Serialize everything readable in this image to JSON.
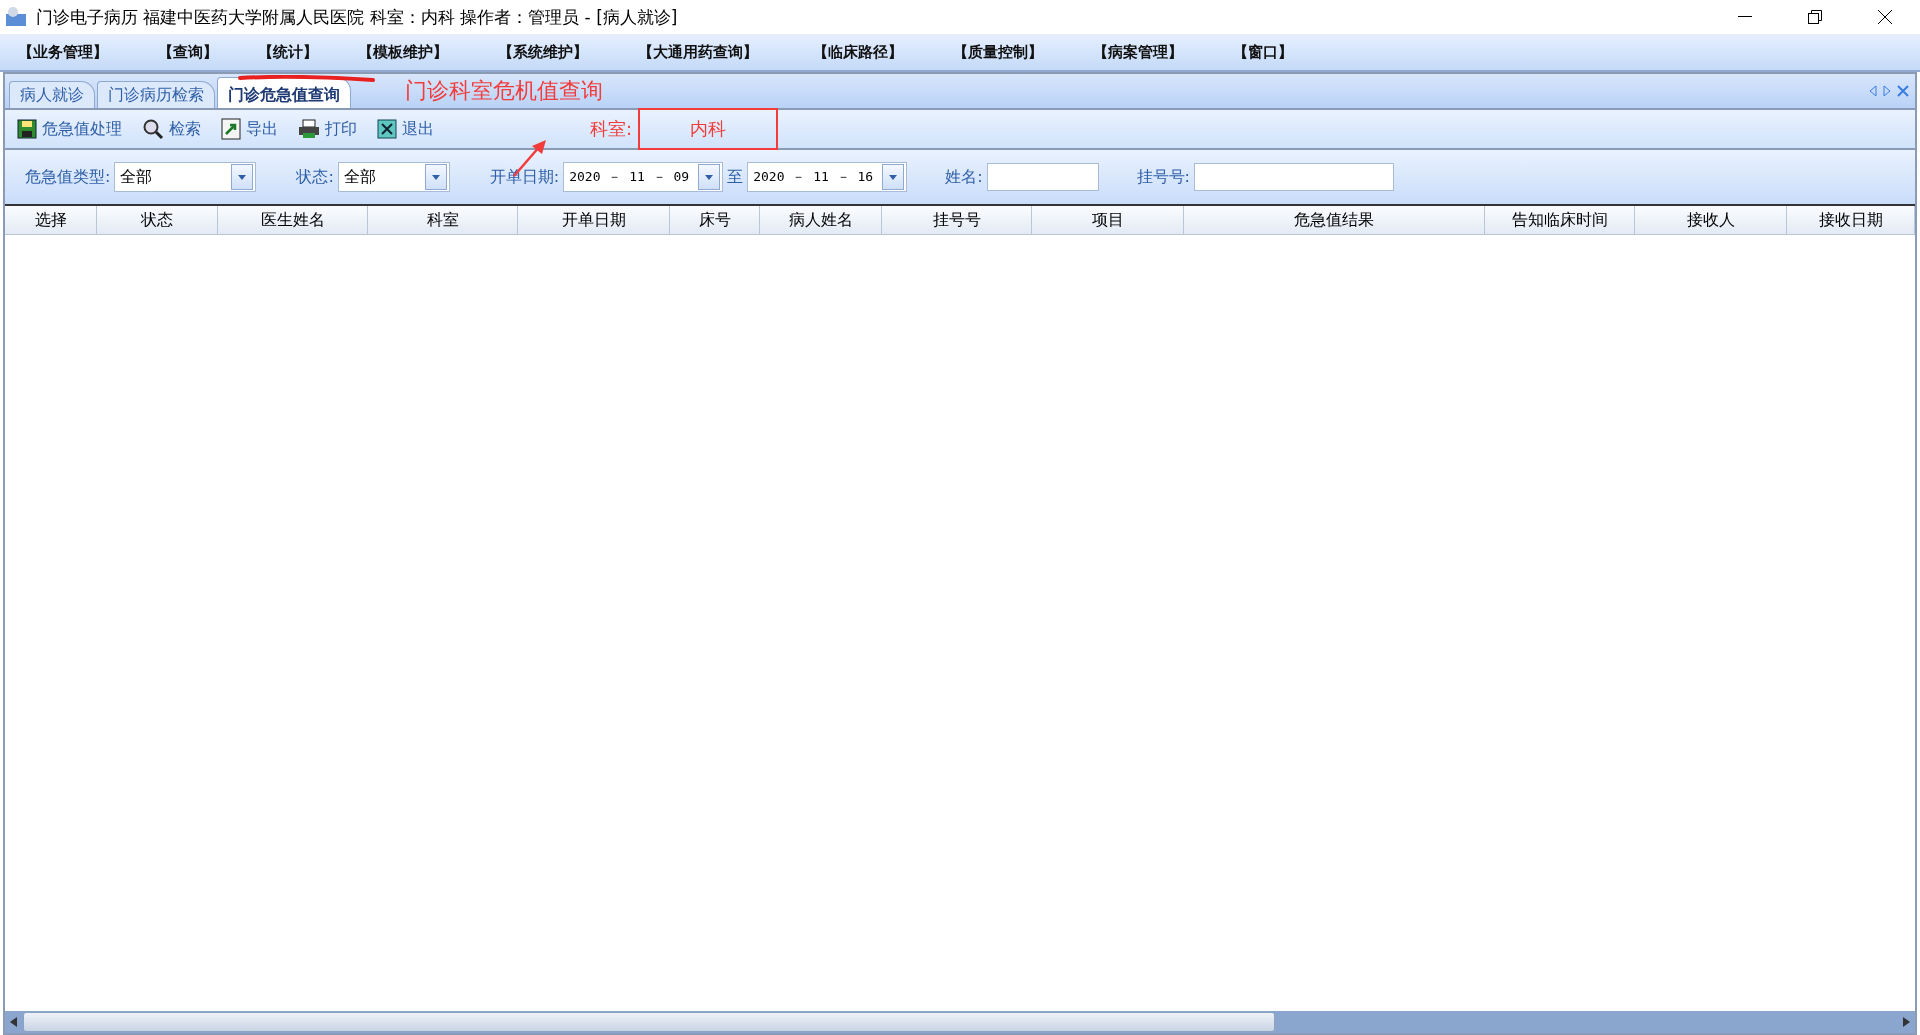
{
  "window": {
    "title": "门诊电子病历  福建中医药大学附属人民医院  科室：内科  操作者：管理员 - [病人就诊]"
  },
  "menu": [
    "【业务管理】",
    "【查询】",
    "【统计】",
    "【模板维护】",
    "【系统维护】",
    "【大通用药查询】",
    "【临床路径】",
    "【质量控制】",
    "【病案管理】",
    "【窗口】"
  ],
  "tabs": [
    {
      "label": "病人就诊",
      "selected": false
    },
    {
      "label": "门诊病历检索",
      "selected": false
    },
    {
      "label": "门诊危急值查询",
      "selected": true
    }
  ],
  "toolbar": [
    {
      "label": "危急值处理",
      "kind": "save"
    },
    {
      "label": "检索",
      "kind": "search"
    },
    {
      "label": "导出",
      "kind": "export"
    },
    {
      "label": "打印",
      "kind": "print"
    },
    {
      "label": "退出",
      "kind": "exit"
    }
  ],
  "filters": {
    "type_label": "危急值类型:",
    "type_value": "全部",
    "status_label": "状态:",
    "status_value": "全部",
    "date_label": "开单日期:",
    "date_from": "2020 － 11 － 09",
    "date_to_label": "至",
    "date_to": "2020 － 11 － 16",
    "name_label": "姓名:",
    "reg_label": "挂号号:"
  },
  "table": {
    "columns": [
      "选择",
      "状态",
      "医生姓名",
      "科室",
      "开单日期",
      "床号",
      "病人姓名",
      "挂号号",
      "项目",
      "危急值结果",
      "告知临床时间",
      "接收人",
      "接收日期"
    ]
  },
  "annotation": {
    "caption": "门诊科室危机值查询",
    "dept_label": "科室:",
    "dept_value": "内科"
  }
}
